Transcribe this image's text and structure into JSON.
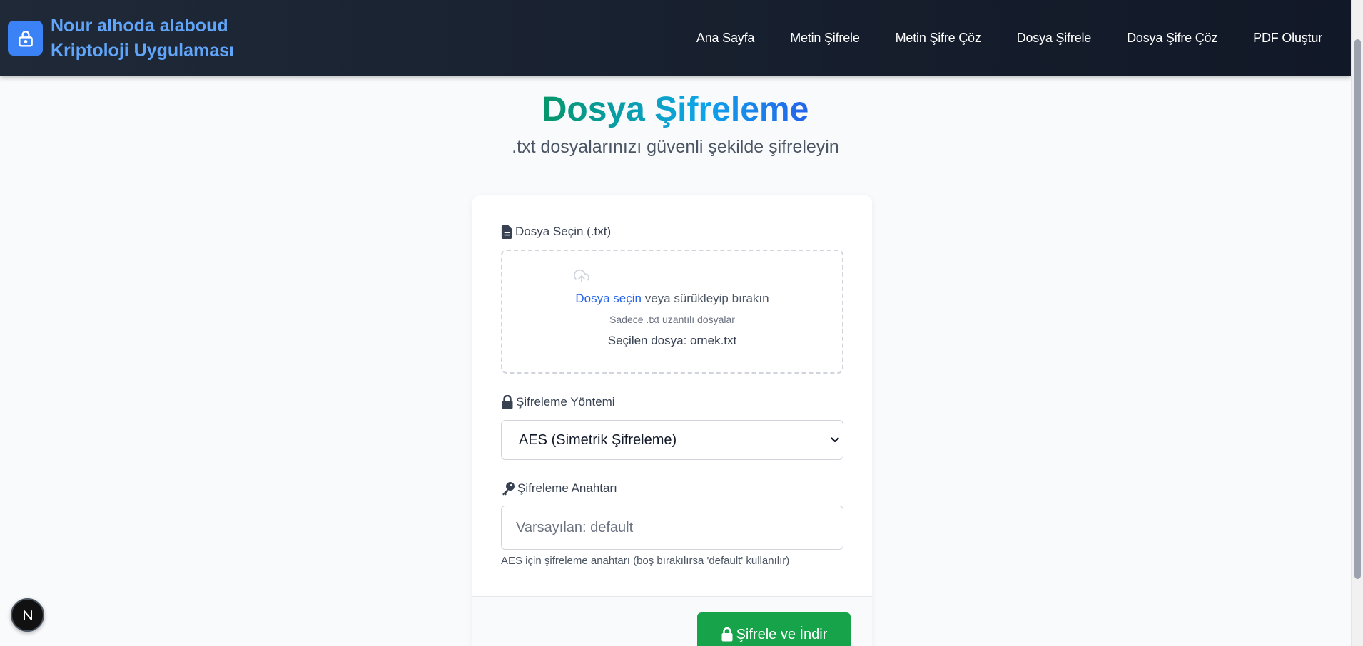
{
  "navbar": {
    "brand_line1": "Nour alhoda alaboud",
    "brand_line2": "Kriptoloji Uygulaması",
    "links": [
      {
        "label": "Ana Sayfa"
      },
      {
        "label": "Metin Şifrele"
      },
      {
        "label": "Metin Şifre Çöz"
      },
      {
        "label": "Dosya Şifrele"
      },
      {
        "label": "Dosya Şifre Çöz"
      },
      {
        "label": "PDF Oluştur"
      }
    ]
  },
  "header": {
    "title": "Dosya Şifreleme",
    "subtitle": ".txt dosyalarınızı güvenli şekilde şifreleyin"
  },
  "form": {
    "file_label": "Dosya Seçin (.txt)",
    "dropzone": {
      "link_text": "Dosya seçin",
      "main_text": " veya sürükleyip bırakın",
      "hint": "Sadece .txt uzantılı dosyalar",
      "selected": "Seçilen dosya: ornek.txt"
    },
    "method_label": "Şifreleme Yöntemi",
    "method_selected": "AES (Simetrik Şifreleme)",
    "key_label": "Şifreleme Anahtarı",
    "key_placeholder": "Varsayılan: default",
    "key_value": "",
    "help_text": "AES için şifreleme anahtarı (boş bırakılırsa 'default' kullanılır)",
    "submit_label": "Şifrele ve İndir"
  },
  "dev_badge": "N",
  "colors": {
    "navbar_bg": "#111827",
    "brand_accent": "#60a5fa",
    "logo_bg": "#3b82f6",
    "link_blue": "#2563eb",
    "submit_green": "#16a34a",
    "title_gradient_start": "#059669",
    "title_gradient_end": "#2563eb"
  },
  "icons": [
    "lock-icon",
    "file-icon",
    "cloud-upload-icon",
    "key-icon",
    "chevron-down-icon",
    "nextjs-icon"
  ]
}
